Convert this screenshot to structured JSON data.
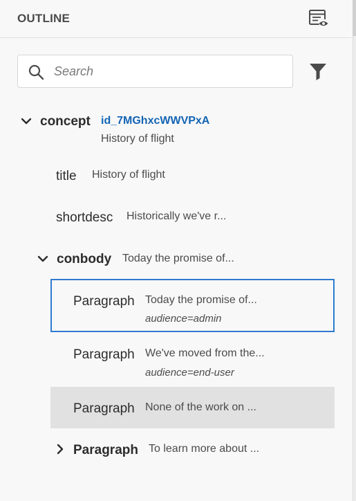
{
  "panel": {
    "title": "OUTLINE",
    "view_options_icon": "table-eye-icon"
  },
  "search": {
    "placeholder": "Search",
    "value": "",
    "icon": "search-icon",
    "filter_icon": "filter-icon"
  },
  "tree": {
    "concept": {
      "tag": "concept",
      "id": "id_7MGhxcWWVPxA",
      "text": "History of flight",
      "expanded": true
    },
    "title": {
      "tag": "title",
      "text": "History of flight"
    },
    "shortdesc": {
      "tag": "shortdesc",
      "text": "Historically we've r..."
    },
    "conbody": {
      "tag": "conbody",
      "text": "Today the promise of...",
      "expanded": true
    },
    "paragraphs": [
      {
        "tag": "Paragraph",
        "text": "Today the promise of...",
        "attr": "audience=admin",
        "state": "selected"
      },
      {
        "tag": "Paragraph",
        "text": "We've moved from the...",
        "attr": "audience=end-user",
        "state": "normal"
      },
      {
        "tag": "Paragraph",
        "text": "None of the work on ...",
        "attr": "",
        "state": "hover"
      },
      {
        "tag": "Paragraph",
        "text": "To learn more about ...",
        "attr": "",
        "state": "collapsed"
      }
    ]
  },
  "colors": {
    "background": "#f8f8f8",
    "id_link": "#1464b4",
    "selection_border": "#2f7ad1",
    "hover_row": "#e1e1e1"
  }
}
